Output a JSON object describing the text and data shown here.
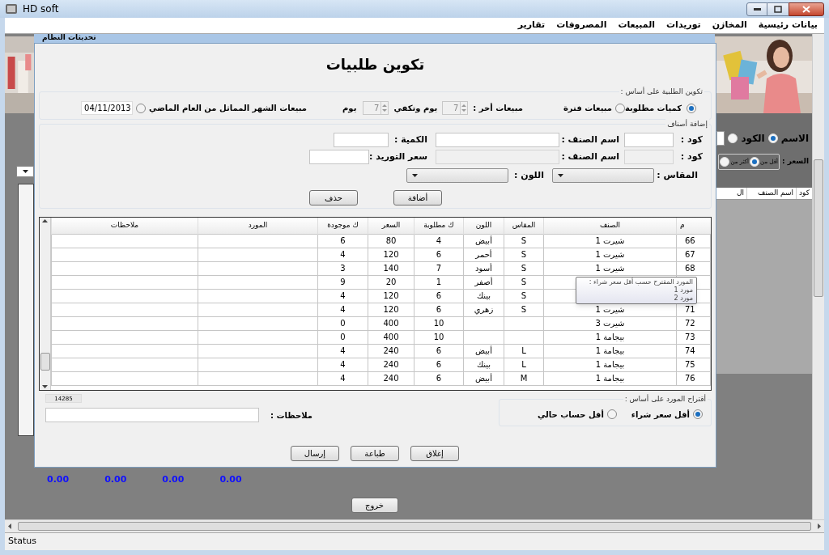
{
  "window": {
    "title": "HD soft"
  },
  "menu": [
    "بيانات رئيسية",
    "المخازن",
    "توريدات",
    "المبيعات",
    "المصروفات",
    "تقارير"
  ],
  "background": {
    "system_updates": "تحديثات النظام",
    "search_by": [
      {
        "label": "الاسم",
        "selected": true
      },
      {
        "label": "الكود",
        "selected": false
      }
    ],
    "price_label": "السعر :",
    "price_options": [
      {
        "label": "أقل من",
        "selected": true
      },
      {
        "label": "أكثر من",
        "selected": false
      }
    ],
    "columns": [
      "كود",
      "اسم الصنف",
      "ال"
    ],
    "totals": [
      "0.00",
      "0.00",
      "0.00",
      "0.00"
    ],
    "exit_button": "خروج"
  },
  "dialog": {
    "title": "تكوين طلبيات",
    "basis": {
      "legend": "تكوين الطلبية على أساس :",
      "options": [
        {
          "label": "كميات مطلوبة",
          "selected": true
        },
        {
          "label": "مبيعات فترة",
          "selected": false
        },
        {
          "label": "مبيعات الشهر المماثل من العام الماضي",
          "selected": false
        }
      ],
      "last_label": "مبيعات أخر :",
      "last_spinner": {
        "value": "7",
        "disabled": true
      },
      "cover_label": "يوم وتكفي",
      "cover_spinner": {
        "value": "7",
        "disabled": true
      },
      "days_label": "يوم",
      "date": "04/11/2013"
    },
    "add_items": {
      "legend": "إضافة أصناف",
      "rows": [
        [
          {
            "label": "كود :",
            "disabled": false
          },
          {
            "label": "اسم الصنف :",
            "disabled": false
          },
          {
            "label": "الكمية :",
            "disabled": false
          }
        ],
        [
          {
            "label": "كود :",
            "disabled": true
          },
          {
            "label": "اسم الصنف :",
            "disabled": true
          },
          {
            "label": "سعر التوريد :",
            "disabled": false
          }
        ]
      ],
      "size_label": "المقاس :",
      "color_label": "اللون :",
      "add_button": "أضافة",
      "delete_button": "حذف"
    },
    "table": {
      "columns": [
        "م",
        "الصنف",
        "المقاس",
        "اللون",
        "ك مطلوبة",
        "السعر",
        "ك موجودة",
        "المورد",
        "ملاحظات"
      ],
      "rows": [
        {
          "num": "66",
          "item": "شيرت 1",
          "size": "S",
          "color_name": "أبيض",
          "qty": "4",
          "price": "80",
          "stock": "6"
        },
        {
          "num": "67",
          "item": "شيرت 1",
          "size": "S",
          "color_name": "أحمر",
          "qty": "6",
          "price": "120",
          "stock": "4"
        },
        {
          "num": "68",
          "item": "شيرت 1",
          "size": "S",
          "color_name": "أسود",
          "qty": "7",
          "price": "140",
          "stock": "3"
        },
        {
          "size": "S",
          "color_name": "أصفر",
          "qty": "1",
          "price": "20",
          "stock": "9"
        },
        {
          "size": "S",
          "color_name": "بينك",
          "qty": "6",
          "price": "120",
          "stock": "4"
        },
        {
          "num": "71",
          "item": "شيرت 1",
          "size": "S",
          "color_name": "زهري",
          "qty": "6",
          "price": "120",
          "stock": "4"
        },
        {
          "num": "72",
          "item": "شيرت 3",
          "qty": "10",
          "price": "400",
          "stock": "0"
        },
        {
          "num": "73",
          "item": "بيجامة 1",
          "qty": "10",
          "price": "400",
          "stock": "0"
        },
        {
          "num": "74",
          "item": "بيجامة 1",
          "size": "L",
          "color_name": "أبيض",
          "qty": "6",
          "price": "240",
          "stock": "4"
        },
        {
          "num": "75",
          "item": "بيجامة 1",
          "size": "L",
          "color_name": "بينك",
          "qty": "6",
          "price": "240",
          "stock": "4"
        },
        {
          "num": "76",
          "item": "بيجامة 1",
          "size": "M",
          "color_name": "أبيض",
          "qty": "6",
          "price": "240",
          "stock": "4"
        }
      ]
    },
    "tooltip": {
      "title": "المورد المقترح حسب أقل سعر شراء :",
      "lines": [
        "مورد 1",
        "مورد 2"
      ]
    },
    "total": "14285",
    "notes_label": "ملاحظات :",
    "supplier_basis": {
      "legend": "أقتراح المورد على أساس :",
      "options": [
        {
          "label": "أقل سعر شراء",
          "selected": true
        },
        {
          "label": "أقل حساب حالي",
          "selected": false
        }
      ]
    },
    "buttons": [
      "إغلاق",
      "طباعة",
      "إرسال"
    ]
  },
  "status_bar": "Status"
}
